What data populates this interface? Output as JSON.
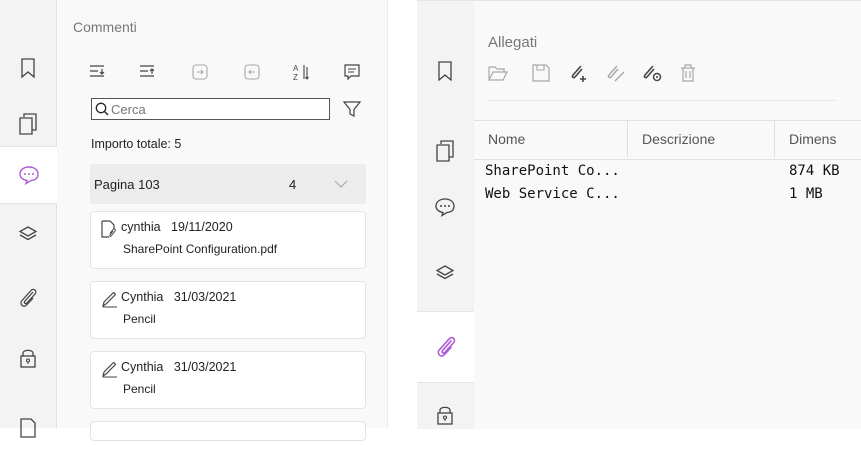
{
  "comments_panel": {
    "title": "Commenti",
    "search_placeholder": "Cerca",
    "total_label": "Importo totale: 5",
    "page_group": {
      "label": "Pagina 103",
      "count": "4"
    },
    "comments": [
      {
        "author": "cynthia",
        "date": "19/11/2020",
        "text": "SharePoint Configuration.pdf",
        "icon": "attachment-comment-icon"
      },
      {
        "author": "Cynthia",
        "date": "31/03/2021",
        "text": "Pencil",
        "icon": "pencil-icon"
      },
      {
        "author": "Cynthia",
        "date": "31/03/2021",
        "text": "Pencil",
        "icon": "pencil-icon"
      }
    ]
  },
  "left_rail": {
    "items": [
      "bookmark-icon",
      "pages-icon",
      "comments-icon",
      "layers-icon",
      "attachments-icon",
      "security-icon",
      "document-icon"
    ],
    "active": "comments-icon"
  },
  "right_rail": {
    "items": [
      "bookmark-icon",
      "pages-icon",
      "comments-icon",
      "layers-icon",
      "attachments-icon",
      "security-icon"
    ],
    "active": "attachments-icon"
  },
  "attachments_panel": {
    "title": "Allegati",
    "toolbar": [
      "open-folder-icon",
      "save-icon",
      "add-attachment-icon",
      "edit-attachment-icon",
      "attachment-settings-icon",
      "delete-icon"
    ],
    "columns": [
      "Nome",
      "Descrizione",
      "Dimens"
    ],
    "rows": [
      {
        "name": "SharePoint Co...",
        "description": "",
        "size": "874 KB"
      },
      {
        "name": "Web Service C...",
        "description": "",
        "size": "1 MB"
      }
    ]
  },
  "colors": {
    "accent": "#9b4fc4",
    "active_icon": "#b05cd6",
    "icon": "#444444",
    "disabled_icon": "#a8a8a8"
  }
}
